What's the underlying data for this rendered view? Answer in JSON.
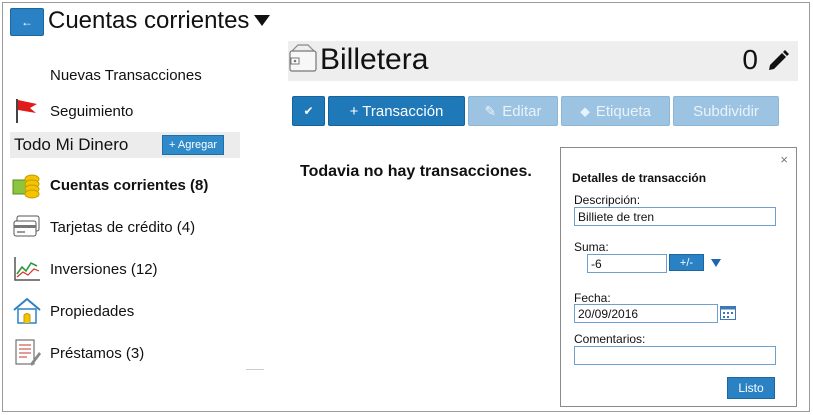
{
  "header": {
    "back_label": "←",
    "account_title": "Cuentas corrientes"
  },
  "sidebar": {
    "top_items": [
      {
        "label": "Nuevas Transacciones"
      },
      {
        "label": "Seguimiento",
        "icon": "red-flag-icon"
      }
    ],
    "group": {
      "title": "Todo Mi Dinero",
      "add_label": "+ Agregar"
    },
    "items": [
      {
        "label": "Cuentas corrientes (8)",
        "icon": "coins-icon",
        "active": true
      },
      {
        "label": "Tarjetas de crédito (4)",
        "icon": "credit-card-icon"
      },
      {
        "label": "Inversiones (12)",
        "icon": "chart-icon"
      },
      {
        "label": "Propiedades",
        "icon": "house-icon"
      },
      {
        "label": "Préstamos (3)",
        "icon": "document-icon"
      }
    ]
  },
  "wallet": {
    "name": "Billetera",
    "balance": "0"
  },
  "toolbar": {
    "check_label": "✔",
    "add_transaction": "+ Transacción",
    "edit": "Editar",
    "tag": "Etiqueta",
    "split": "Subdividir"
  },
  "main": {
    "empty_message": "Todavia no hay transacciones."
  },
  "details": {
    "close": "×",
    "title": "Detalles de transacción",
    "description_label": "Descripción:",
    "description_value": "Billiete de tren",
    "amount_label": "Suma:",
    "amount_value": "-6",
    "sign_toggle": "+/-",
    "date_label": "Fecha:",
    "date_value": "20/09/2016",
    "comments_label": "Comentarios:",
    "comments_value": "",
    "done": "Listo"
  },
  "colors": {
    "primary": "#2a82c4",
    "disabled": "#9cc4e2",
    "panel_border": "#8a8a8a"
  }
}
